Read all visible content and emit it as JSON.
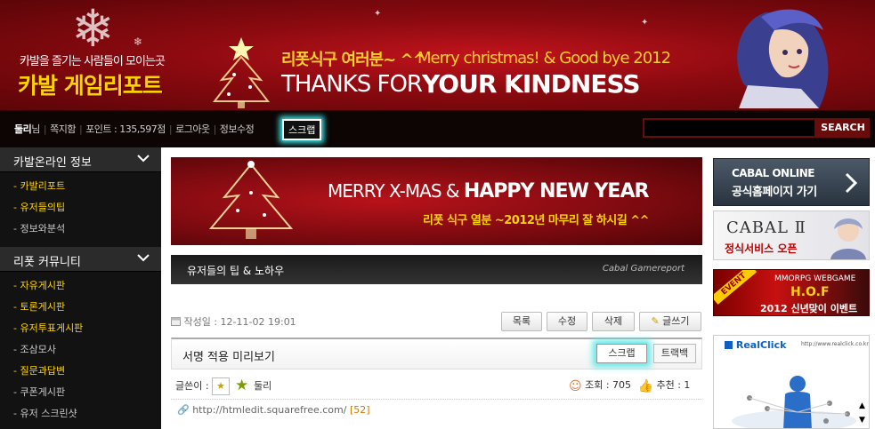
{
  "header": {
    "brand_subtitle": "카발을 즐기는 사람들이 모이는곳",
    "brand_title": "카발 게임리포트",
    "headline_ko": "리폿식구 여러분~ ^^",
    "headline_en": "Merry christmas! & Good bye 2012",
    "tagline_a": "THANKS FOR",
    "tagline_b": "YOUR KINDNESS"
  },
  "navbar": {
    "username": "둘리",
    "username_suffix": "님",
    "messages": "쪽지함",
    "points": "포인트 : 135,597점",
    "logout": "로그아웃",
    "edit_info": "정보수정",
    "scrap": "스크랩",
    "search_button": "SEARCH",
    "search_value": ""
  },
  "sidebar": {
    "section1": {
      "title": "카발온라인 정보",
      "items": [
        "- 카발리포트",
        "- 유저들의팁",
        "- 정보와분석"
      ]
    },
    "section2": {
      "title": "리폿 커뮤니티",
      "items": [
        "- 자유게시판",
        "- 토론게시판",
        "- 유저투표게시판",
        "- 조삼모사",
        "- 질문과답변",
        "- 쿠폰게시판",
        "- 유저 스크린샷"
      ]
    }
  },
  "main": {
    "banner_line1_a": "MERRY X-MAS &",
    "banner_line1_b": "HAPPY NEW YEAR",
    "banner_line2": "리폿 식구 열분 ~2012년 마무리 잘 하시길 ^^",
    "section_title": "유저들의 팁 & 노하우",
    "section_brand": "Cabal Gamereport",
    "date": "작성일 : 12-11-02 19:01",
    "buttons": {
      "list": "목록",
      "edit": "수정",
      "delete": "삭제",
      "write": "글쓰기",
      "scrap": "스크랩",
      "trackback": "트랙백"
    },
    "post_title": "서명 적용 미리보기",
    "author_label": "글쓴이 :",
    "author": "둘리",
    "views": "조회 : 705",
    "recommend": "추천 : 1",
    "link": "http://htmledit.squarefree.com/",
    "link_count": "[52]"
  },
  "ads": {
    "ad1_line1": "CABAL ONLINE",
    "ad1_line2": "공식홈페이지 가기",
    "ad2_logo": "CABAL Ⅱ",
    "ad2_text": "정식서비스 오픈",
    "ad3_tag": "EVENT",
    "ad3_line1": "MMORPG WEBGAME",
    "ad3_line2": "H.O.F",
    "ad3_line3": "2012 신년맞이 이벤트",
    "ad4_logo": "RealClick",
    "ad4_url": "http://www.realclick.co.kr"
  }
}
